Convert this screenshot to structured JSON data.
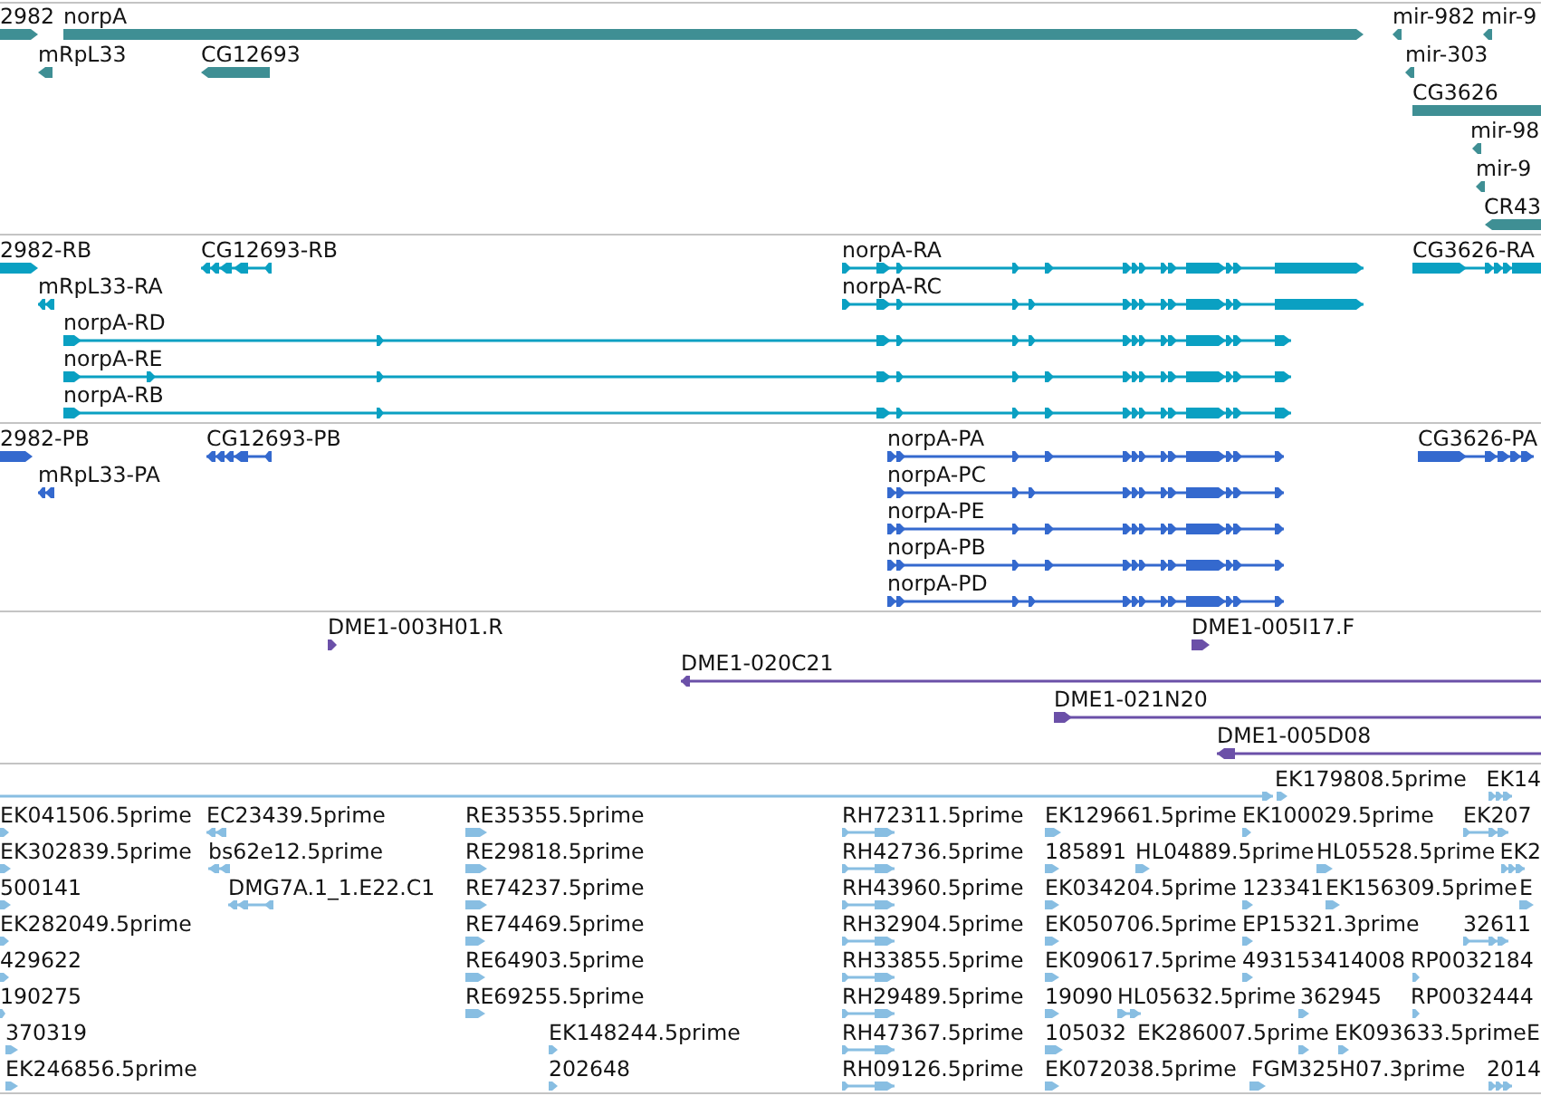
{
  "tracks": [
    {
      "color": "#3f8f94",
      "rows": [
        {
          "features": [
            {
              "label": "2982",
              "reverse": false
            },
            {
              "label": "norpA",
              "reverse": false
            },
            {
              "label": "mir-982",
              "reverse": true
            },
            {
              "label": "mir-9",
              "reverse": true
            }
          ]
        },
        {
          "features": [
            {
              "label": "mRpL33",
              "reverse": true
            },
            {
              "label": "CG12693",
              "reverse": true
            },
            {
              "label": "mir-303",
              "reverse": true
            }
          ]
        },
        {
          "features": [
            {
              "label": "CG3626",
              "reverse": false
            }
          ]
        },
        {
          "features": [
            {
              "label": "mir-98",
              "reverse": true
            }
          ]
        },
        {
          "features": [
            {
              "label": "mir-9",
              "reverse": true
            }
          ]
        },
        {
          "features": [
            {
              "label": "CR43",
              "reverse": true
            }
          ]
        }
      ]
    },
    {
      "color": "#0aa0c2",
      "rows": [
        {
          "features": [
            {
              "label": "2982-RB",
              "reverse": false
            },
            {
              "label": "CG12693-RB",
              "reverse": true
            },
            {
              "label": "norpA-RA",
              "reverse": false
            },
            {
              "label": "CG3626-RA",
              "reverse": false
            }
          ]
        },
        {
          "features": [
            {
              "label": "mRpL33-RA",
              "reverse": true
            },
            {
              "label": "norpA-RC",
              "reverse": false
            }
          ]
        },
        {
          "features": [
            {
              "label": "norpA-RD",
              "reverse": false
            }
          ]
        },
        {
          "features": [
            {
              "label": "norpA-RE",
              "reverse": false
            }
          ]
        },
        {
          "features": [
            {
              "label": "norpA-RB",
              "reverse": false
            }
          ]
        }
      ]
    },
    {
      "color": "#3469ce",
      "rows": [
        {
          "features": [
            {
              "label": "2982-PB",
              "reverse": false
            },
            {
              "label": "CG12693-PB",
              "reverse": true
            },
            {
              "label": "norpA-PA",
              "reverse": false
            },
            {
              "label": "CG3626-PA",
              "reverse": false
            }
          ]
        },
        {
          "features": [
            {
              "label": "mRpL33-PA",
              "reverse": true
            },
            {
              "label": "norpA-PC",
              "reverse": false
            }
          ]
        },
        {
          "features": [
            {
              "label": "norpA-PE",
              "reverse": false
            }
          ]
        },
        {
          "features": [
            {
              "label": "norpA-PB",
              "reverse": false
            }
          ]
        },
        {
          "features": [
            {
              "label": "norpA-PD",
              "reverse": false
            }
          ]
        }
      ]
    },
    {
      "color": "#6b50a8",
      "rows": [
        {
          "features": [
            {
              "label": "DME1-003H01.R",
              "reverse": false
            },
            {
              "label": "DME1-005I17.F",
              "reverse": false
            }
          ]
        },
        {
          "features": [
            {
              "label": "DME1-020C21",
              "reverse": true
            }
          ]
        },
        {
          "features": [
            {
              "label": "DME1-021N20",
              "reverse": false
            }
          ]
        },
        {
          "features": [
            {
              "label": "DME1-005D08",
              "reverse": true
            }
          ]
        }
      ]
    },
    {
      "color": "#88bee2",
      "rows": [
        {
          "features": [
            {
              "reverse": false
            },
            {
              "label": "EK179808.5prime",
              "reverse": false
            },
            {
              "label": "EK14",
              "reverse": false
            }
          ]
        },
        {
          "features": [
            {
              "label": "EK041506.5prime",
              "reverse": false
            },
            {
              "label": "EC23439.5prime",
              "reverse": true
            },
            {
              "label": "RE35355.5prime",
              "reverse": false
            },
            {
              "label": "RH72311.5prime",
              "reverse": false
            },
            {
              "label": "EK129661.5prime",
              "reverse": false
            },
            {
              "label": "EK100029.5prime",
              "reverse": false
            },
            {
              "label": "EK207",
              "reverse": false
            }
          ]
        },
        {
          "features": [
            {
              "label": "EK302839.5prime",
              "reverse": false
            },
            {
              "label": "bs62e12.5prime",
              "reverse": true
            },
            {
              "label": "RE29818.5prime",
              "reverse": false
            },
            {
              "label": "RH42736.5prime",
              "reverse": false
            },
            {
              "label": "185891",
              "reverse": false
            },
            {
              "label": "HL04889.5prime",
              "reverse": false
            },
            {
              "label": "HL05528.5prime",
              "reverse": false
            },
            {
              "label": "EK2",
              "reverse": false
            }
          ]
        },
        {
          "features": [
            {
              "label": "500141",
              "reverse": false
            },
            {
              "label": "DMG7A.1_1.E22.C1",
              "reverse": true
            },
            {
              "label": "RE74237.5prime",
              "reverse": false
            },
            {
              "label": "RH43960.5prime",
              "reverse": false
            },
            {
              "label": "EK034204.5prime",
              "reverse": false
            },
            {
              "label": "123341",
              "reverse": false
            },
            {
              "label": "EK156309.5prime",
              "reverse": false
            },
            {
              "label": "E",
              "reverse": false
            }
          ]
        },
        {
          "features": [
            {
              "label": "EK282049.5prime",
              "reverse": false
            },
            {
              "label": "RE74469.5prime",
              "reverse": false
            },
            {
              "label": "RH32904.5prime",
              "reverse": false
            },
            {
              "label": "EK050706.5prime",
              "reverse": false
            },
            {
              "label": "EP15321.3prime",
              "reverse": false
            },
            {
              "label": "32611",
              "reverse": false
            }
          ]
        },
        {
          "features": [
            {
              "label": "429622",
              "reverse": false
            },
            {
              "label": "RE64903.5prime",
              "reverse": false
            },
            {
              "label": "RH33855.5prime",
              "reverse": false
            },
            {
              "label": "EK090617.5prime",
              "reverse": false
            },
            {
              "label": "493153414008",
              "reverse": false
            },
            {
              "label": "RP0032184",
              "reverse": false
            }
          ]
        },
        {
          "features": [
            {
              "label": "190275",
              "reverse": false
            },
            {
              "label": "RE69255.5prime",
              "reverse": false
            },
            {
              "label": "RH29489.5prime",
              "reverse": false
            },
            {
              "label": "19090",
              "reverse": false
            },
            {
              "label": "HL05632.5prime",
              "reverse": false
            },
            {
              "label": "362945",
              "reverse": false
            },
            {
              "label": "RP0032444",
              "reverse": false
            }
          ]
        },
        {
          "features": [
            {
              "label": "370319",
              "reverse": false
            },
            {
              "label": "EK148244.5prime",
              "reverse": false
            },
            {
              "label": "RH47367.5prime",
              "reverse": false
            },
            {
              "label": "105032",
              "reverse": false
            },
            {
              "label": "EK286007.5prime",
              "reverse": false
            },
            {
              "label": "EK093633.5prime",
              "reverse": false
            },
            {
              "label": "E"
            }
          ]
        },
        {
          "features": [
            {
              "label": "EK246856.5prime",
              "reverse": false
            },
            {
              "label": "202648",
              "reverse": false
            },
            {
              "label": "RH09126.5prime",
              "reverse": false
            },
            {
              "label": "EK072038.5prime",
              "reverse": false
            },
            {
              "label": "FGM325H07.3prime",
              "reverse": false
            },
            {
              "label": "2014",
              "reverse": false
            }
          ]
        }
      ]
    }
  ]
}
